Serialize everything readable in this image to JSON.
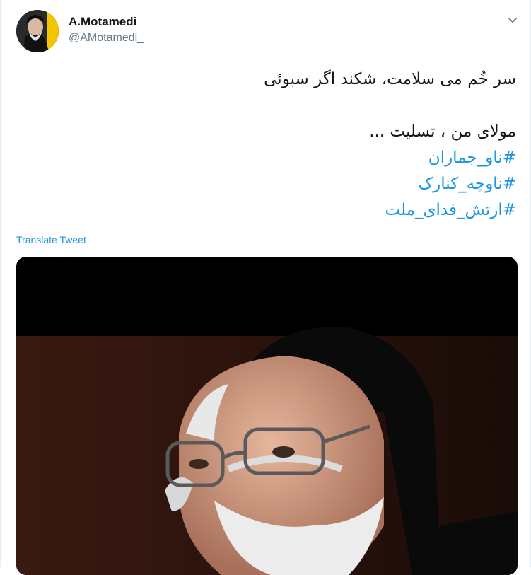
{
  "user": {
    "display_name": "A.Motamedi",
    "handle": "@AMotamedi_"
  },
  "tweet": {
    "line1": "سر خُم می سلامت، شکند اگر سبوئی",
    "line2": "مولای من ، تسلیت ...",
    "hashtags": [
      "#ناو_جماران",
      "#ناوچه_کنارک",
      "#ارتش_فدای_ملت"
    ]
  },
  "translate_label": "Translate Tweet",
  "icons": {
    "caret": "chevron-down-icon",
    "avatar": "avatar-photo"
  },
  "colors": {
    "link": "#1b95e0",
    "secondary": "#657786",
    "text": "#14171a",
    "avatar_accent": "#f2c500"
  }
}
